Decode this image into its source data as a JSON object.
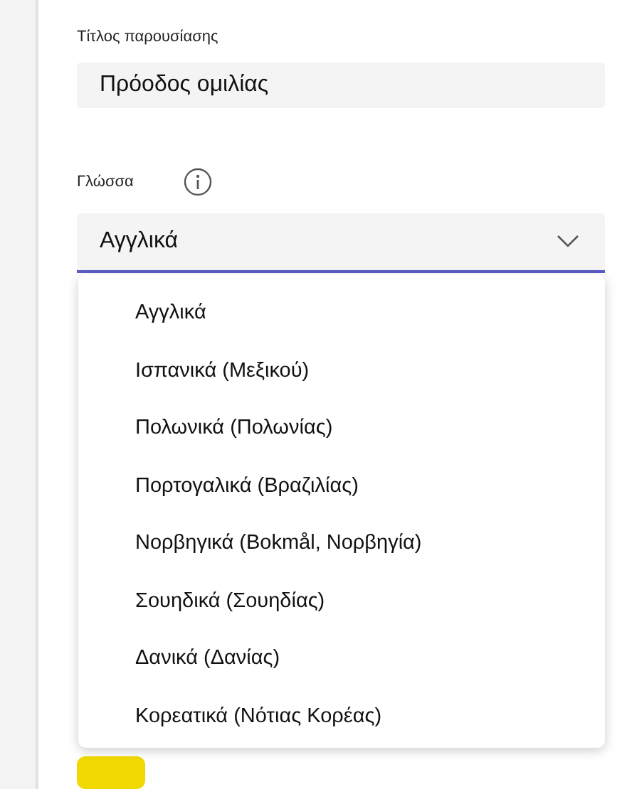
{
  "title_field": {
    "label": "Τίτλος παρουσίασης",
    "value": "Πρόοδος ομιλίας"
  },
  "language": {
    "label": "Γλώσσα",
    "value": "Αγγλικά",
    "expanded": true,
    "options": [
      "Αγγλικά",
      "Ισπανικά (Μεξικού)",
      "Πολωνικά (Πολωνίας)",
      "Πορτογαλικά (Βραζιλίας)",
      "Νορβηγικά (Bokmål, Νορβηγία)",
      "Σουηδικά (Σουηδίας)",
      "Δανικά (Δανίας)",
      "Κορεατικά (Νότιας Κορέας)"
    ]
  }
}
